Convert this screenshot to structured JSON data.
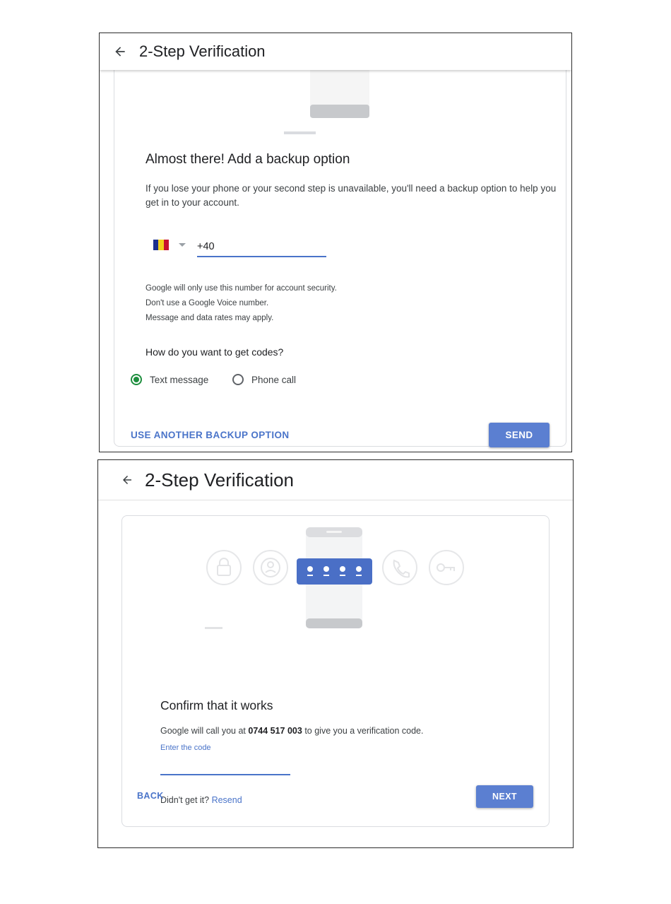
{
  "screen1": {
    "title": "2-Step Verification",
    "heading": "Almost there! Add a backup option",
    "description": "If you lose your phone or your second step is unavailable, you'll need a backup option to help you get in to your account.",
    "phone": {
      "country_code": "+40"
    },
    "notes": [
      "Google will only use this number for account security.",
      "Don't use a Google Voice number.",
      "Message and data rates may apply."
    ],
    "codes_question": "How do you want to get codes?",
    "options": [
      {
        "label": "Text message",
        "selected": true
      },
      {
        "label": "Phone call",
        "selected": false
      }
    ],
    "secondary_action": "USE ANOTHER BACKUP OPTION",
    "primary_action": "SEND"
  },
  "screen2": {
    "title": "2-Step Verification",
    "heading": "Confirm that it works",
    "description_prefix": "Google will call you at ",
    "phone_number": "0744 517 003",
    "description_suffix": " to give you a verification code.",
    "code_label": "Enter the code",
    "code_value": "",
    "resend_prompt": "Didn't get it? ",
    "resend_link": "Resend",
    "back_label": "BACK",
    "next_label": "NEXT"
  },
  "colors": {
    "accent": "#4a74c9",
    "button": "#5b7fd1",
    "radio_selected": "#1e8e3e",
    "flag_blue": "#1b2f8f",
    "flag_yellow": "#f2cf1a",
    "flag_red": "#c8102e"
  },
  "icons": [
    "back-arrow-icon",
    "lock-icon",
    "account-icon",
    "phone-handset-icon",
    "key-icon",
    "smartphone-illustration"
  ]
}
